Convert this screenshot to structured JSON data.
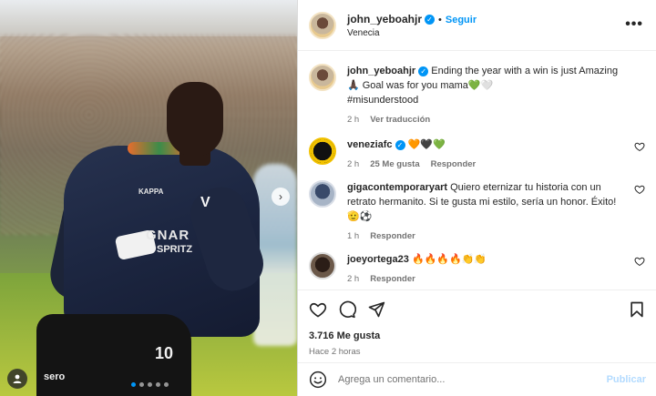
{
  "post": {
    "username": "john_yeboahjr",
    "follow_label": "Seguir",
    "location": "Venecia",
    "more_label": "•••",
    "caption_text": "Ending the year with a win is just Amazing🙏🏿 Goal was for you mama💚🤍",
    "hashtag": "#misunderstood",
    "time": "2 h",
    "see_translation": "Ver traducción"
  },
  "photo": {
    "shirt_sponsor": "GNAR",
    "shirt_sponsor_sub": "SPRITZ",
    "shirt_crest": "V",
    "shirt_brand": "KAPPA",
    "shorts_number": "10",
    "shorts_brand": "sero",
    "next_arrow": "›"
  },
  "comments": [
    {
      "username": "veneziafc",
      "text": "🧡🖤💚",
      "time": "2 h",
      "likes": "25 Me gusta",
      "reply": "Responder"
    },
    {
      "username": "gigacontemporaryart",
      "text": "Quiero eternizar tu historia con un retrato hermanito. Si te gusta mi estilo, sería un honor. Éxito! 🫡⚽",
      "time": "1 h",
      "reply": "Responder"
    },
    {
      "username": "joeyortega23",
      "text": "🔥🔥🔥🔥👏👏",
      "time": "2 h",
      "reply": "Responder"
    }
  ],
  "stats": {
    "likes": "3.716 Me gusta",
    "ago": "Hace 2 horas"
  },
  "composer": {
    "placeholder": "Agrega un comentario...",
    "publish_label": "Publicar"
  },
  "colors": {
    "accent": "#0095f6",
    "muted": "#737373",
    "text": "#262626"
  }
}
